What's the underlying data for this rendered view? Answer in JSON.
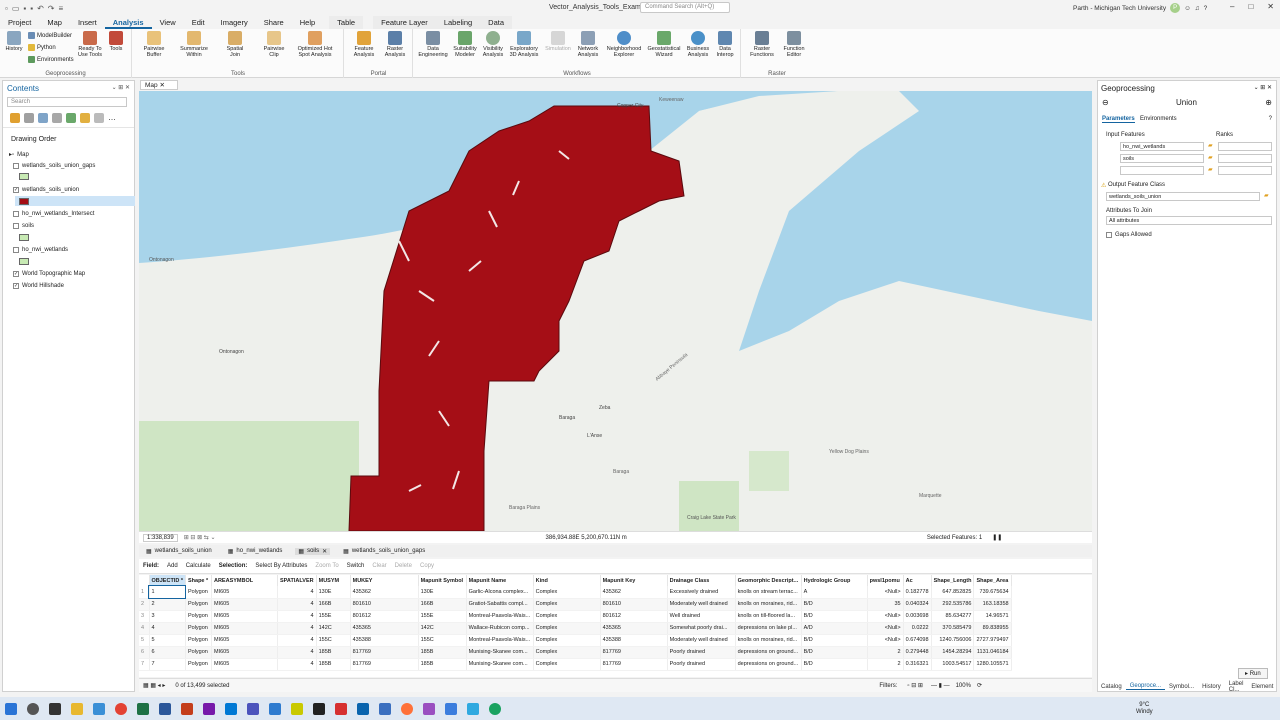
{
  "window": {
    "title": "Vector_Analysis_Tools_Examples",
    "search_placeholder": "Command Search (Alt+Q)",
    "user": "Parth - Michigan Tech University",
    "avatar": "P"
  },
  "tabs": [
    "Project",
    "Map",
    "Insert",
    "Analysis",
    "View",
    "Edit",
    "Imagery",
    "Share",
    "Help",
    "Table",
    "Feature Layer",
    "Labeling",
    "Data"
  ],
  "ribbon": {
    "geoprocessing": {
      "label": "Geoprocessing",
      "history": "History",
      "modelbuilder": "ModelBuilder",
      "python": "Python",
      "environments": "Environments",
      "ready": "Ready To\nUse Tools",
      "tools": "Tools"
    },
    "tools": {
      "label": "Tools",
      "items": [
        "Pairwise\nBuffer",
        "Summarize\nWithin",
        "Spatial\nJoin",
        "Pairwise\nClip",
        "Optimized Hot\nSpot Analysis"
      ]
    },
    "portal": {
      "label": "Portal",
      "items": [
        "Feature\nAnalysis",
        "Raster\nAnalysis"
      ]
    },
    "workflows": {
      "label": "Workflows",
      "items": [
        "Data\nEngineering",
        "Suitability\nModeler",
        "Visibility\nAnalysis",
        "Exploratory\n3D Analysis",
        "Simulation",
        "Network\nAnalysis",
        "Neighborhood\nExplorer",
        "Geostatistical\nWizard",
        "Business\nAnalysis",
        "Data\nInterop"
      ]
    },
    "raster": {
      "label": "Raster",
      "items": [
        "Raster\nFunctions",
        "Function\nEditor"
      ]
    }
  },
  "contents": {
    "title": "Contents",
    "search_placeholder": "Search",
    "drawing_order": "Drawing Order",
    "map": "Map",
    "layers": [
      {
        "name": "wetlands_soils_union_gaps",
        "checked": false,
        "swatch": "#c8eab4"
      },
      {
        "name": "wetlands_soils_union",
        "checked": true,
        "swatch": "#a50e16"
      },
      {
        "name": "ho_nwi_wetlands_Intersect",
        "checked": false,
        "swatch": ""
      },
      {
        "name": "soils",
        "checked": false,
        "swatch": "#c8eab4"
      },
      {
        "name": "ho_nwi_wetlands",
        "checked": false,
        "swatch": "#c8eab4"
      },
      {
        "name": "World Topographic Map",
        "checked": true,
        "swatch": ""
      },
      {
        "name": "World Hillshade",
        "checked": true,
        "swatch": ""
      }
    ]
  },
  "map": {
    "tab": "Map",
    "labels": [
      "Copper City",
      "Ontonagon",
      "Ontonagon",
      "Baraga",
      "L'Anse",
      "Zeba",
      "Baraga",
      "Yellow Dog\nPlains",
      "Marquette",
      "Craig Lake\nState Park",
      "Baraga\nPlains",
      "Keweenaw",
      "Abbaye Peninsula"
    ],
    "scale": "1:338,839",
    "coords": "386,934.88E 5,200,670.11N m",
    "selected": "Selected Features: 1"
  },
  "table": {
    "tabs": [
      "wetlands_soils_union",
      "ho_nwi_wetlands",
      "soils",
      "wetlands_soils_union_gaps"
    ],
    "toolbar": {
      "field": "Field:",
      "add": "Add",
      "calculate": "Calculate",
      "selection": "Selection:",
      "select_by_attr": "Select By Attributes",
      "zoom_to": "Zoom To",
      "switch": "Switch",
      "clear": "Clear",
      "delete": "Delete",
      "copy": "Copy"
    },
    "columns": [
      "OBJECTID *",
      "Shape *",
      "AREASYMBOL",
      "SPATIALVER",
      "MUSYM",
      "MUKEY",
      "Mapunit Symbol",
      "Mapunit Name",
      "Kind",
      "Mapunit Key",
      "Drainage Class",
      "Geomorphic Descript...",
      "Hydrologic Group",
      "pwsl1pomu",
      "Ac",
      "Shape_Length",
      "Shape_Area"
    ],
    "rows": [
      [
        "1",
        "Polygon",
        "MI605",
        "4",
        "130E",
        "435362",
        "130E",
        "Garlic-Alcona complex...",
        "Complex",
        "435362",
        "Excessively drained",
        "knolls on stream terrac...",
        "A",
        "<Null>",
        "0.182778",
        "647.852825",
        "739.675634"
      ],
      [
        "2",
        "Polygon",
        "MI605",
        "4",
        "166B",
        "801610",
        "166B",
        "Gratiot-Sabattis compl...",
        "Complex",
        "801610",
        "Moderately well drained",
        "knolls on moraines, rid...",
        "B/D",
        "35",
        "0.040324",
        "292.535786",
        "163.18358"
      ],
      [
        "3",
        "Polygon",
        "MI605",
        "4",
        "155E",
        "801612",
        "155E",
        "Montreal-Paavola-Wais...",
        "Complex",
        "801612",
        "Well drained",
        "knolls on till-floored la...",
        "B/D",
        "<Null>",
        "0.003698",
        "85.634277",
        "14.96571"
      ],
      [
        "4",
        "Polygon",
        "MI605",
        "4",
        "142C",
        "435365",
        "142C",
        "Wallace-Rubicon comp...",
        "Complex",
        "435365",
        "Somewhat poorly drai...",
        "depressions on lake pl...",
        "A/D",
        "<Null>",
        "0.0222",
        "370.585479",
        "89.838955"
      ],
      [
        "5",
        "Polygon",
        "MI605",
        "4",
        "155C",
        "435388",
        "155C",
        "Montreal-Paavola-Wais...",
        "Complex",
        "435388",
        "Moderately well drained",
        "knolls on moraines, rid...",
        "B/D",
        "<Null>",
        "0.674098",
        "1240.756006",
        "2727.979497"
      ],
      [
        "6",
        "Polygon",
        "MI605",
        "4",
        "185B",
        "817769",
        "185B",
        "Munising-Skanee com...",
        "Complex",
        "817769",
        "Poorly drained",
        "depressions on ground...",
        "B/D",
        "2",
        "0.279448",
        "1454.28294",
        "1131.046184"
      ],
      [
        "7",
        "Polygon",
        "MI605",
        "4",
        "185B",
        "817769",
        "185B",
        "Munising-Skanee com...",
        "Complex",
        "817769",
        "Poorly drained",
        "depressions on ground...",
        "B/D",
        "2",
        "0.316321",
        "1003.54517",
        "1280.105571"
      ]
    ],
    "selected": "0 of 13,499 selected",
    "filters": "Filters:",
    "zoom": "100%"
  },
  "gp": {
    "title": "Geoprocessing",
    "tool": "Union",
    "tab_params": "Parameters",
    "tab_env": "Environments",
    "input_features": "Input Features",
    "ranks": "Ranks",
    "inputs": [
      "ho_nwi_wetlands",
      "soils",
      ""
    ],
    "output_label": "Output Feature Class",
    "output_value": "wetlands_soils_union",
    "attr_label": "Attributes To Join",
    "attr_value": "All attributes",
    "gaps": "Gaps Allowed",
    "run": "Run",
    "bottom_tabs": [
      "Catalog",
      "Geoproce...",
      "Symbol...",
      "History",
      "Label Cl...",
      "Element"
    ]
  },
  "taskbar": {
    "weather": "9°C",
    "weather_desc": "Windy"
  }
}
